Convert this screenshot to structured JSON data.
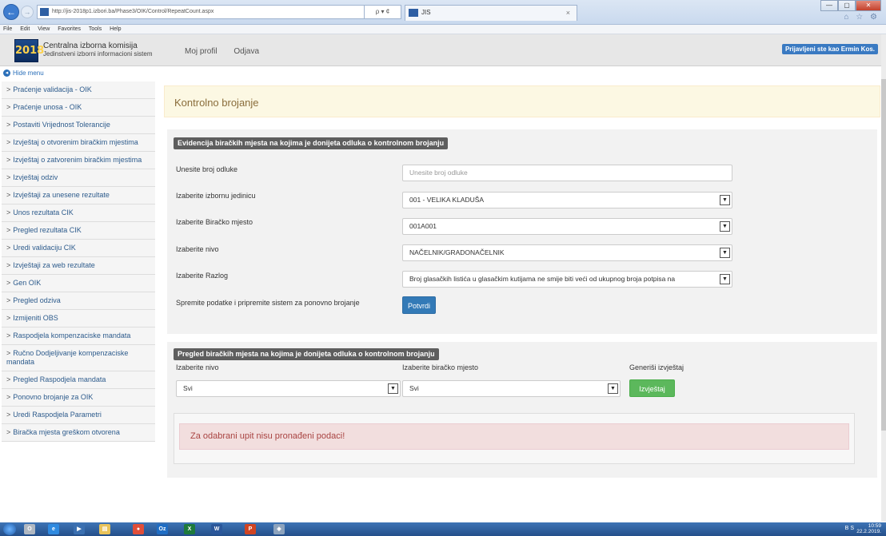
{
  "browser": {
    "url": "http://jis-2018p1.izbori.ba/Phase3/OIK/Control/RepeatCount.aspx",
    "addr_tools": "ρ ▾ ¢",
    "tab_title": "JIS",
    "tab_close": "×",
    "menu": [
      "File",
      "Edit",
      "View",
      "Favorites",
      "Tools",
      "Help"
    ],
    "win_controls": [
      "—",
      "▢",
      "✕"
    ],
    "right_icons": "⌂ ☆ ⚙"
  },
  "header": {
    "logo_text": "2018",
    "brand_title": "Centralna izborna komisija",
    "brand_subtitle": "Jedinstveni izborni informacioni sistem",
    "nav": [
      "Moj profil",
      "Odjava"
    ],
    "user_badge": "Prijavljeni ste kao Ermin Kos."
  },
  "hide_menu": "Hide menu",
  "sidebar": {
    "items": [
      "Praćenje validacija - OIK",
      "Praćenje unosa - OIK",
      "Postaviti Vrijednost Tolerancije",
      "Izvještaj o otvorenim biračkim mjestima",
      "Izvještaj o zatvorenim biračkim mjestima",
      "Izvještaj odziv",
      "Izvještaji za unesene rezultate",
      "Unos rezultata CIK",
      "Pregled rezultata CIK",
      "Uredi validaciju CIK",
      "Izvještaji za web rezultate",
      "Gen OIK",
      "Pregled odziva",
      "Izmijeniti OBS",
      "Raspodjela kompenzaciske mandata",
      "Ručno Dodjeljivanje kompenzaciske mandata",
      "Pregled Raspodjela mandata",
      "Ponovno brojanje za OIK",
      "Uredi Raspodjela Parametri",
      "Biračka mjesta greškom otvorena"
    ]
  },
  "main": {
    "title": "Kontrolno brojanje",
    "panel1": {
      "legend": "Evidencija biračkih mjesta na kojima je donijeta odluka o kontrolnom brojanju",
      "decision_label": "Unesite broj odluke",
      "decision_placeholder": "Unesite broj odluke",
      "unit_label": "Izaberite izbornu jedinicu",
      "unit_value": "001 - VELIKA KLADUŠA",
      "station_label": "Izaberite Biračko mjesto",
      "station_value": "001A001",
      "level_label": "Izaberite nivo",
      "level_value": "NAČELNIK/GRADONAČELNIK",
      "reason_label": "Izaberite Razlog",
      "reason_value": "Broj glasačkih listića u glasačkim kutijama ne smije biti veći od ukupnog broja potpisa na",
      "save_label": "Spremite podatke i pripremite sistem za ponovno brojanje",
      "confirm_button": "Potvrdi"
    },
    "panel2": {
      "legend": "Pregled biračkih mjesta na kojima je donijeta odluka o kontrolnom brojanju",
      "level_label": "Izaberite nivo",
      "level_value": "Svi",
      "station_label": "Izaberite biračko mjesto",
      "station_value": "Svi",
      "report_label": "Generiši izvještaj",
      "report_button": "Izvještaj",
      "alert": "Za odabrani upit nisu pronađeni podaci!"
    }
  },
  "taskbar": {
    "apps": [
      "O",
      "e",
      "▶",
      "▤",
      "●",
      "Oz",
      "X",
      "W",
      "P",
      "◈"
    ],
    "tray": "BS",
    "time": "10:59",
    "date": "22.2.2019."
  },
  "colors": {
    "primary": "#337ab7",
    "success": "#5cb85c",
    "danger_text": "#a94442",
    "warning_bg": "#fcf8e3"
  }
}
